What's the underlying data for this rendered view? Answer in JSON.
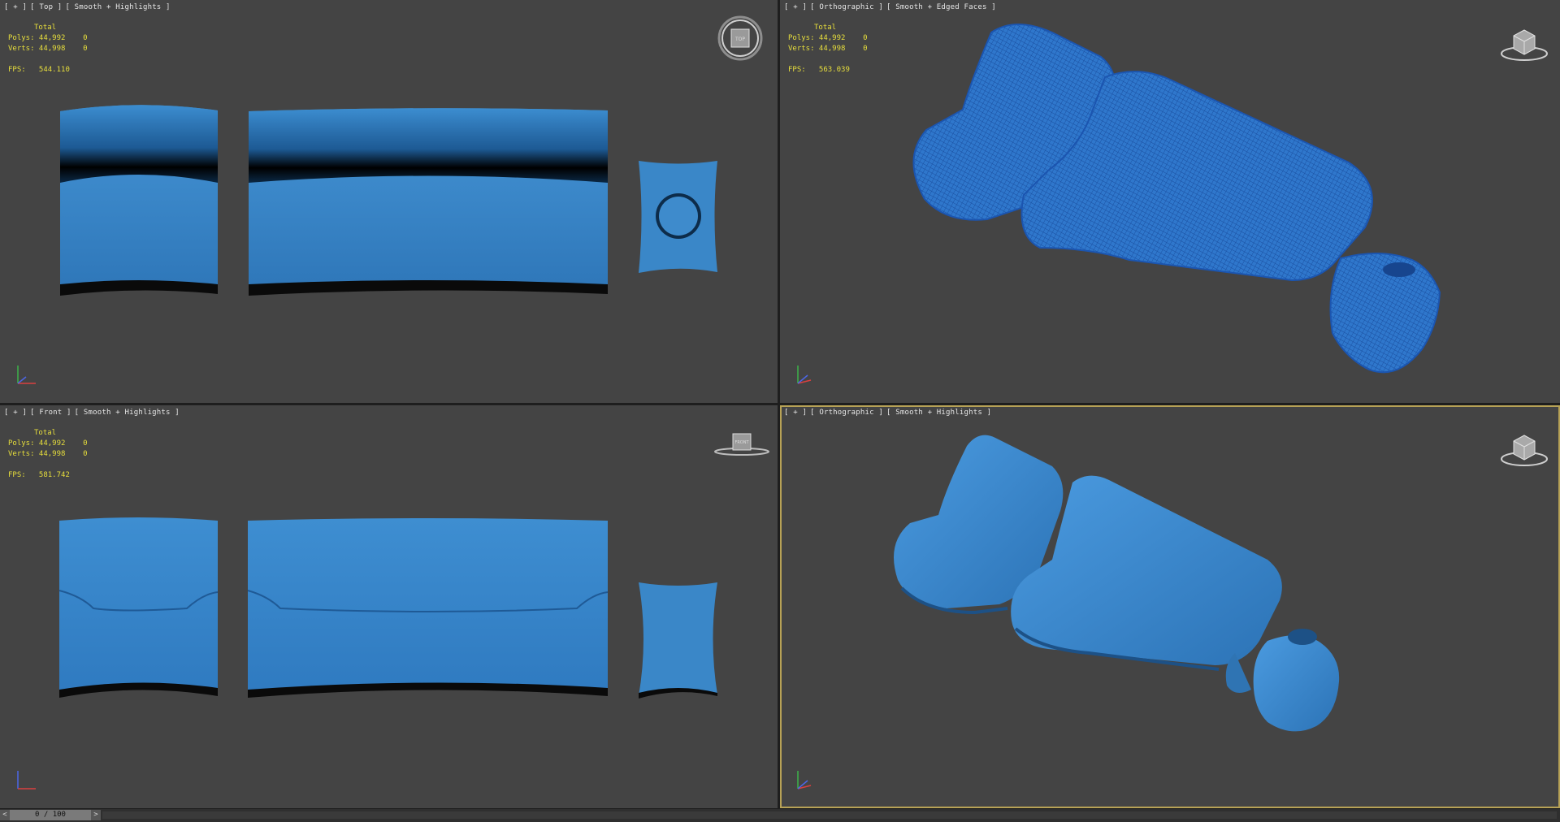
{
  "viewports": {
    "top": {
      "plus": "[ + ]",
      "view": "[ Top ]",
      "shading": "[ Smooth + Highlights ]",
      "gizmo_label": "TOP",
      "stats": {
        "header": "Total",
        "polys": "Polys: 44,992    0",
        "verts": "Verts: 44,998    0",
        "fps": "FPS:   544.110"
      }
    },
    "persp1": {
      "plus": "[ + ]",
      "view": "[ Orthographic ]",
      "shading": "[ Smooth + Edged Faces ]",
      "stats": {
        "header": "Total",
        "polys": "Polys: 44,992    0",
        "verts": "Verts: 44,998    0",
        "fps": "FPS:   563.039"
      }
    },
    "front": {
      "plus": "[ + ]",
      "view": "[ Front ]",
      "shading": "[ Smooth + Highlights ]",
      "gizmo_label": "FRONT",
      "stats": {
        "header": "Total",
        "polys": "Polys: 44,992    0",
        "verts": "Verts: 44,998    0",
        "fps": "FPS:   581.742"
      }
    },
    "persp2": {
      "plus": "[ + ]",
      "view": "[ Orthographic ]",
      "shading": "[ Smooth + Highlights ]"
    }
  },
  "timeline": {
    "frame": "0 / 100",
    "prev": "<",
    "next": ">"
  },
  "colors": {
    "viewport_bg": "#444444",
    "model": "#3a87c8",
    "stats_text": "#e8df3c",
    "active_border": "#b7a256"
  }
}
